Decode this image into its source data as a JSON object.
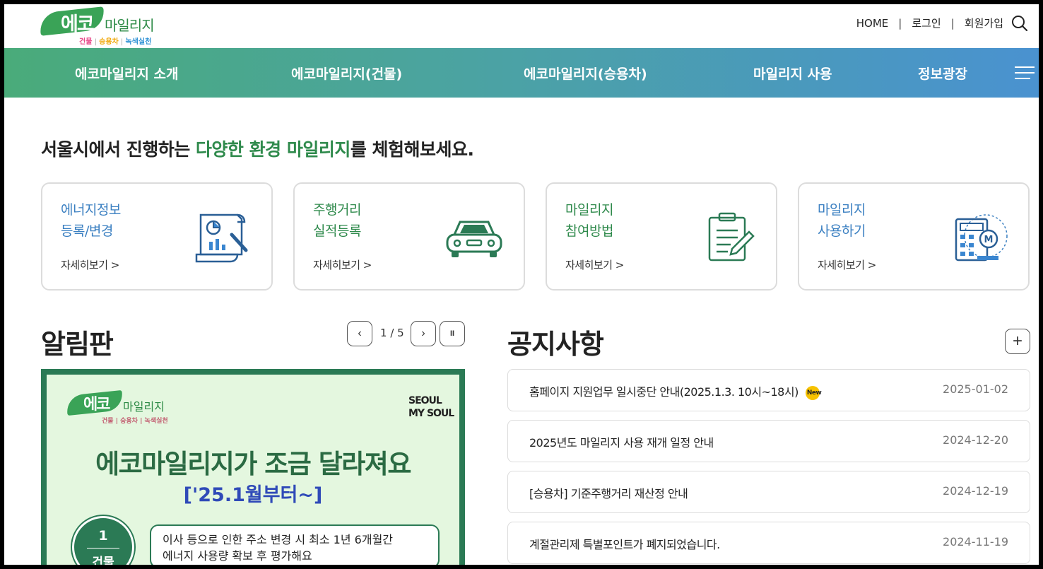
{
  "logo": {
    "eco": "에코",
    "mileage": "마일리지",
    "sub": [
      "건물",
      "승용차",
      "녹색실천"
    ]
  },
  "topnav": {
    "home": "HOME",
    "login": "로그인",
    "signup": "회원가입",
    "separator": "|"
  },
  "gnb": {
    "items": [
      "에코마일리지 소개",
      "에코마일리지(건물)",
      "에코마일리지(승용차)",
      "마일리지 사용",
      "정보광장"
    ]
  },
  "headline": {
    "before": "서울시에서 진행하는 ",
    "highlight": "다양한 환경 마일리지",
    "after": "를 체험해보세요."
  },
  "cards": [
    {
      "title": "에너지정보\n등록/변경",
      "more": "자세히보기 >",
      "color": "#3a7fc1"
    },
    {
      "title": "주행거리\n실적등록",
      "more": "자세히보기 >",
      "color": "#2f8a4c"
    },
    {
      "title": "마일리지\n참여방법",
      "more": "자세히보기 >",
      "color": "#2f8a4c"
    },
    {
      "title": "마일리지\n사용하기",
      "more": "자세히보기 >",
      "color": "#3a7fc1"
    }
  ],
  "board": {
    "title": "알림판",
    "prev": "‹",
    "next": "›",
    "pause": "II",
    "current": "1",
    "total": "/ 5"
  },
  "banner": {
    "eco": "에코",
    "mileage": "마일리지",
    "sub": "건물 | 승용차 | 녹색실천",
    "seoul": "SEOUL\nMY SOUL",
    "title": "에코마일리지가 조금 달라져요",
    "subtitle": "['25.1월부터~]",
    "step_number": "1",
    "step_label": "건물",
    "step_text": "이사 등으로 인한 주소 변경 시 최소 1년 6개월간\n에너지 사용량 확보 후 평가해요"
  },
  "notices": {
    "title": "공지사항",
    "plus": "+",
    "new_label": "New",
    "items": [
      {
        "title": "홈페이지 지원업무 일시중단 안내(2025.1.3. 10시~18시)",
        "date": "2025-01-02",
        "is_new": true
      },
      {
        "title": "2025년도 마일리지 사용 재개 일정 안내",
        "date": "2024-12-20",
        "is_new": false
      },
      {
        "title": "[승용차] 기준주행거리 재산정 안내",
        "date": "2024-12-19",
        "is_new": false
      },
      {
        "title": "계절관리제 특별포인트가 폐지되었습니다.",
        "date": "2024-11-19",
        "is_new": false
      }
    ]
  }
}
